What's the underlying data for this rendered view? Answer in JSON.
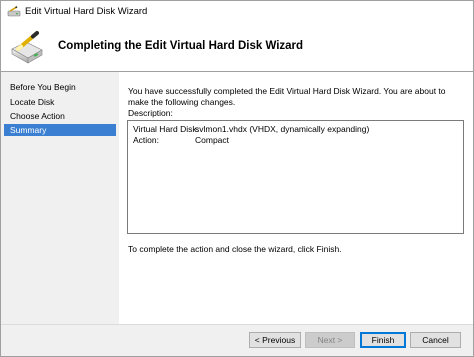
{
  "window": {
    "title": "Edit Virtual Hard Disk Wizard",
    "title_icon": "disk-wand-icon"
  },
  "header": {
    "title": "Completing the Edit Virtual Hard Disk Wizard",
    "icon": "disk-wand-icon"
  },
  "nav": {
    "items": [
      {
        "label": "Before You Begin",
        "selected": false
      },
      {
        "label": "Locate Disk",
        "selected": false
      },
      {
        "label": "Choose Action",
        "selected": false
      },
      {
        "label": "Summary",
        "selected": true
      }
    ],
    "selected_color": "#3a7fd2"
  },
  "content": {
    "intro": "You have successfully completed the Edit Virtual Hard Disk Wizard. You are about to make the following changes.",
    "description_label": "Description:",
    "description": [
      {
        "key": "Virtual Hard Disk:",
        "value": "svlmon1.vhdx (VHDX, dynamically expanding)"
      },
      {
        "key": "Action:",
        "value": "Compact"
      }
    ],
    "finish_note": "To complete the action and close the wizard, click Finish."
  },
  "buttons": {
    "previous": "< Previous",
    "next": "Next >",
    "finish": "Finish",
    "cancel": "Cancel"
  }
}
